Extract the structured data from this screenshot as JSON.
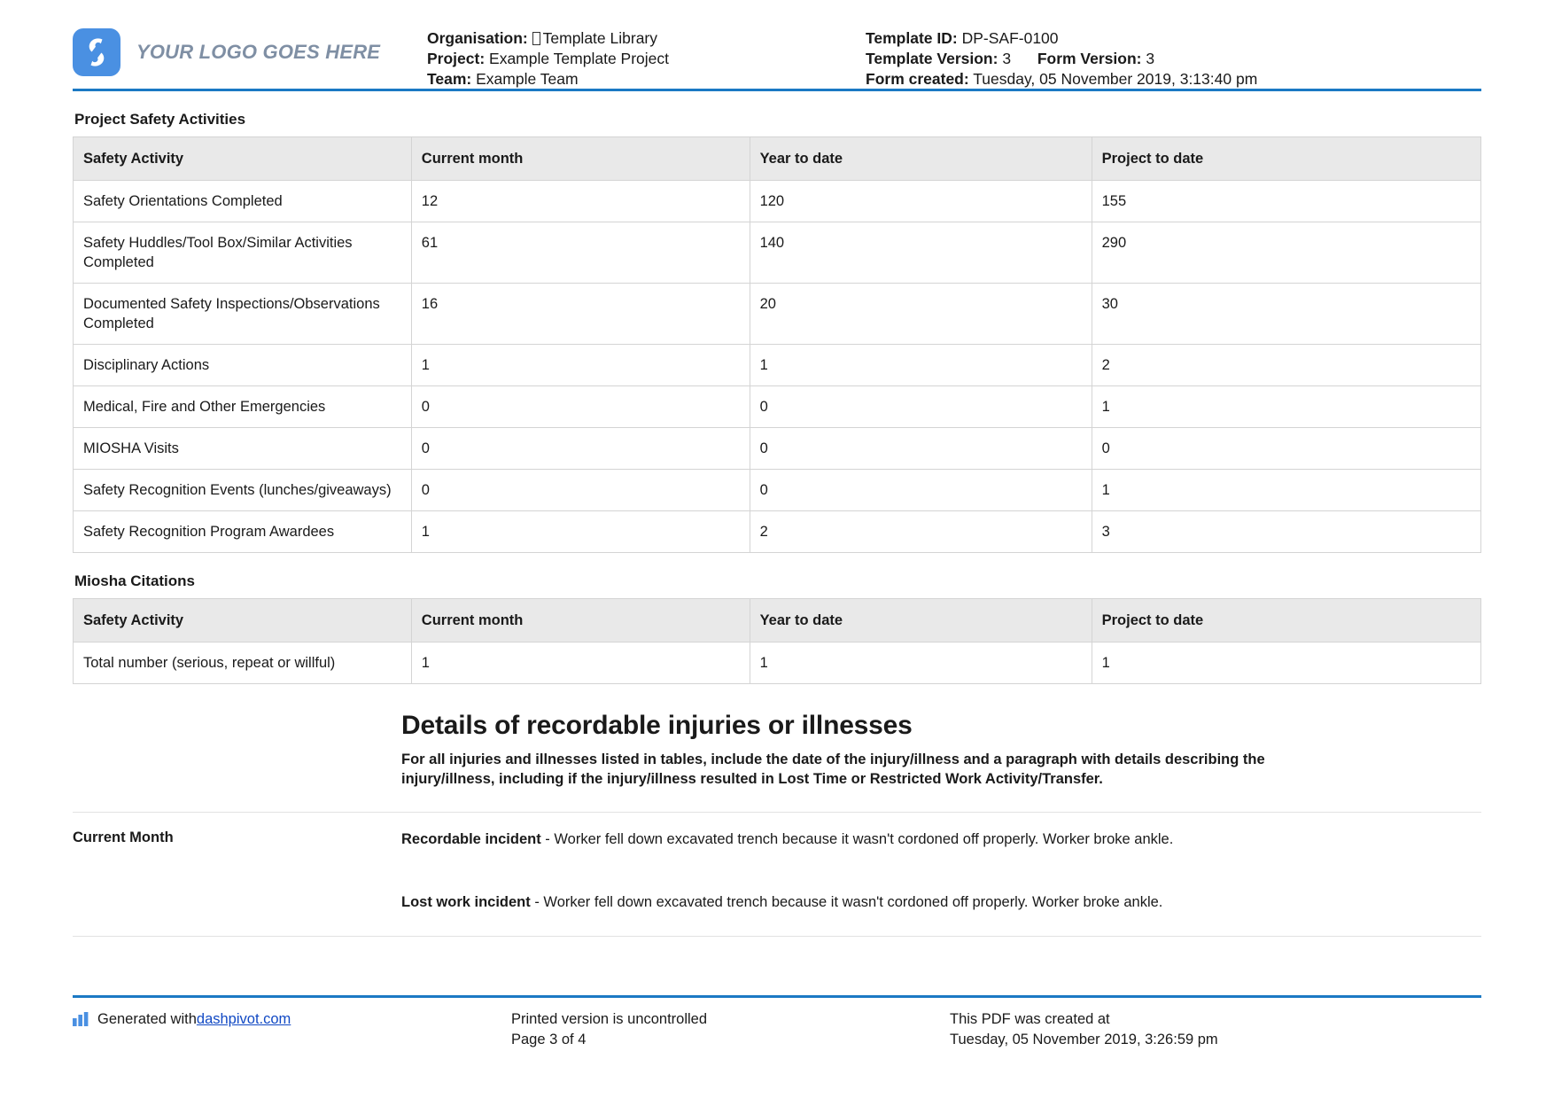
{
  "header": {
    "logo_text": "YOUR LOGO GOES HERE",
    "logo_icon": "dashpivot-s-logo-icon",
    "organisation_label": "Organisation:",
    "organisation_value": "Template Library",
    "project_label": "Project:",
    "project_value": "Example Template Project",
    "team_label": "Team:",
    "team_value": "Example Team",
    "template_id_label": "Template ID:",
    "template_id_value": "DP-SAF-0100",
    "template_version_label": "Template Version:",
    "template_version_value": "3",
    "form_version_label": "Form Version:",
    "form_version_value": "3",
    "form_created_label": "Form created:",
    "form_created_value": "Tuesday, 05 November 2019, 3:13:40 pm"
  },
  "safety_activities": {
    "title": "Project Safety Activities",
    "columns": [
      "Safety Activity",
      "Current month",
      "Year to date",
      "Project to date"
    ],
    "rows": [
      {
        "activity": "Safety Orientations Completed",
        "current_month": "12",
        "year_to_date": "120",
        "project_to_date": "155"
      },
      {
        "activity": "Safety Huddles/Tool Box/Similar Activities Completed",
        "current_month": "61",
        "year_to_date": "140",
        "project_to_date": "290"
      },
      {
        "activity": "Documented Safety Inspections/Observations Completed",
        "current_month": "16",
        "year_to_date": "20",
        "project_to_date": "30"
      },
      {
        "activity": "Disciplinary Actions",
        "current_month": "1",
        "year_to_date": "1",
        "project_to_date": "2"
      },
      {
        "activity": "Medical, Fire and Other Emergencies",
        "current_month": "0",
        "year_to_date": "0",
        "project_to_date": "1"
      },
      {
        "activity": "MIOSHA Visits",
        "current_month": "0",
        "year_to_date": "0",
        "project_to_date": "0"
      },
      {
        "activity": "Safety Recognition Events (lunches/giveaways)",
        "current_month": "0",
        "year_to_date": "0",
        "project_to_date": "1"
      },
      {
        "activity": "Safety Recognition Program Awardees",
        "current_month": "1",
        "year_to_date": "2",
        "project_to_date": "3"
      }
    ]
  },
  "miosha_citations": {
    "title": "Miosha Citations",
    "columns": [
      "Safety Activity",
      "Current month",
      "Year to date",
      "Project to date"
    ],
    "rows": [
      {
        "activity": "Total number (serious, repeat or willful)",
        "current_month": "1",
        "year_to_date": "1",
        "project_to_date": "1"
      }
    ]
  },
  "details": {
    "heading": "Details of recordable injuries or illnesses",
    "subheading": "For all injuries and illnesses listed in tables, include the date of the injury/illness and a paragraph with details describing the injury/illness, including if the injury/illness resulted in Lost Time or Restricted Work Activity/Transfer.",
    "current_month_label": "Current Month",
    "recordable_label": "Recordable incident",
    "recordable_text": " - Worker fell down excavated trench because it wasn't cordoned off properly. Worker broke ankle.",
    "lost_work_label": "Lost work incident",
    "lost_work_text": " - Worker fell down excavated trench because it wasn't cordoned off properly. Worker broke ankle."
  },
  "footer": {
    "generated_prefix": "Generated with ",
    "generated_link": "dashpivot.com",
    "printed_notice": "Printed version is uncontrolled",
    "page_number": "Page 3 of 4",
    "created_label": "This PDF was created at",
    "created_value": "Tuesday, 05 November 2019, 3:26:59 pm"
  },
  "colors": {
    "accent": "#1b79c4",
    "logo_blue": "#4a90e2",
    "header_row": "#e9e9e9",
    "link": "#1149c4"
  }
}
